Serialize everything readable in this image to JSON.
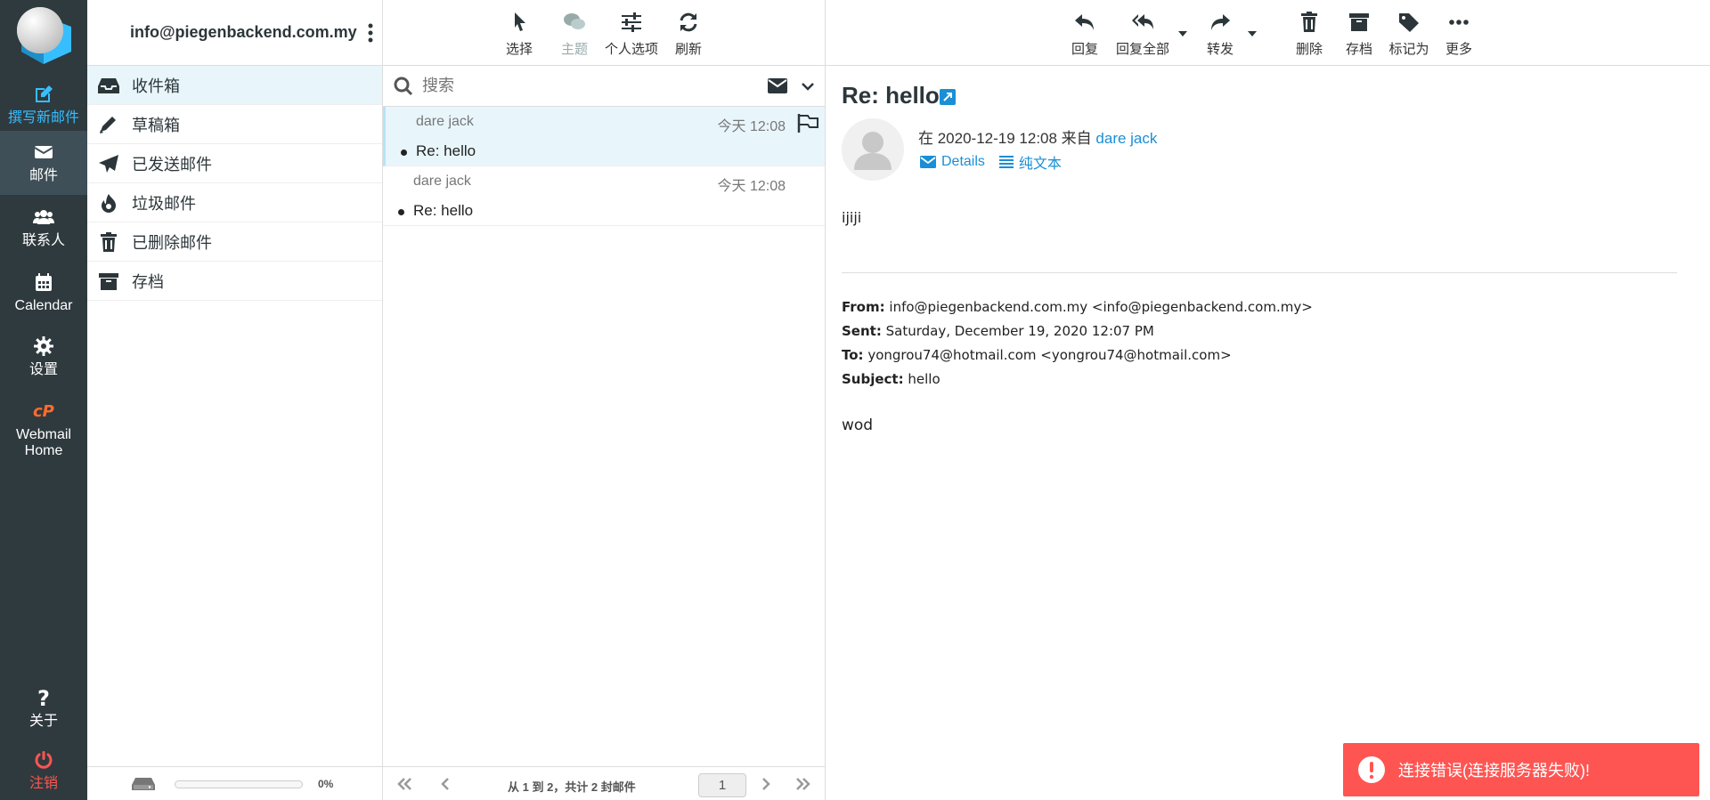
{
  "nav": {
    "compose": "撰写新邮件",
    "mail": "邮件",
    "contacts": "联系人",
    "calendar": "Calendar",
    "settings": "设置",
    "webmail_home": "Webmail Home",
    "about": "关于",
    "logout": "注销"
  },
  "account": {
    "email": "info@piegenbackend.com.my"
  },
  "folders": [
    {
      "label": "收件箱",
      "icon": "inbox-icon"
    },
    {
      "label": "草稿箱",
      "icon": "pencil-icon"
    },
    {
      "label": "已发送邮件",
      "icon": "paper-plane-icon"
    },
    {
      "label": "垃圾邮件",
      "icon": "fire-icon"
    },
    {
      "label": "已删除邮件",
      "icon": "trash-icon"
    },
    {
      "label": "存档",
      "icon": "archive-icon"
    }
  ],
  "quota": {
    "percent_label": "0%",
    "fraction": 0
  },
  "list_toolbar": {
    "select": "选择",
    "threads": "主题",
    "options": "个人选项",
    "refresh": "刷新"
  },
  "search": {
    "placeholder": "搜索"
  },
  "messages": [
    {
      "from": "dare jack",
      "date": "今天 12:08",
      "subject": "Re: hello"
    },
    {
      "from": "dare jack",
      "date": "今天 12:08",
      "subject": "Re: hello"
    }
  ],
  "pagination": {
    "info": "从 1 到 2，共计 2 封邮件",
    "page": "1"
  },
  "view_toolbar": {
    "reply": "回复",
    "reply_all": "回复全部",
    "forward": "转发",
    "delete": "删除",
    "archive": "存档",
    "mark": "标记为",
    "more": "更多"
  },
  "message": {
    "subject": "Re: hello",
    "date_prefix": "在 2020-12-19 12:08 来自",
    "sender": "dare jack",
    "details": "Details",
    "plain_text": "纯文本",
    "body_top": "ijiji",
    "quoted": {
      "from_label": "From:",
      "from": "info@piegenbackend.com.my <info@piegenbackend.com.my>",
      "sent_label": "Sent:",
      "sent": "Saturday, December 19, 2020 12:07 PM",
      "to_label": "To:",
      "to": "yongrou74@hotmail.com <yongrou74@hotmail.com>",
      "subject_label": "Subject:",
      "subject": "hello"
    },
    "body_bottom": "wod"
  },
  "toast": {
    "text": "连接错误(连接服务器失败)!"
  },
  "colors": {
    "nav_bg": "#2f3a3f",
    "accent": "#37beff",
    "error": "#ff5552",
    "selected_bg": "#e8f6fc"
  }
}
